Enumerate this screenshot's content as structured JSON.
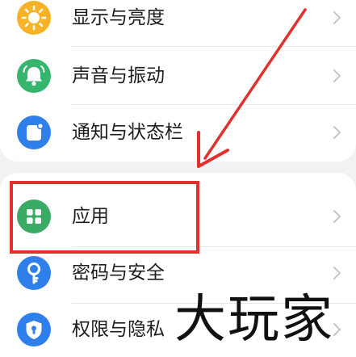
{
  "settings": {
    "items": [
      {
        "label": "显示与亮度",
        "icon": "sun-icon",
        "color": "#f5b325"
      },
      {
        "label": "声音与振动",
        "icon": "bell-icon",
        "color": "#35b56e"
      },
      {
        "label": "通知与状态栏",
        "icon": "notification-icon",
        "color": "#2f7fea"
      },
      {
        "label": "应用",
        "icon": "apps-grid-icon",
        "color": "#3aaa64"
      },
      {
        "label": "密码与安全",
        "icon": "key-icon",
        "color": "#2f7fea"
      },
      {
        "label": "权限与隐私",
        "icon": "shield-icon",
        "color": "#2f7fea"
      }
    ]
  },
  "annotation": {
    "color": "#e0312e"
  },
  "watermark": {
    "text": "大玩家"
  }
}
